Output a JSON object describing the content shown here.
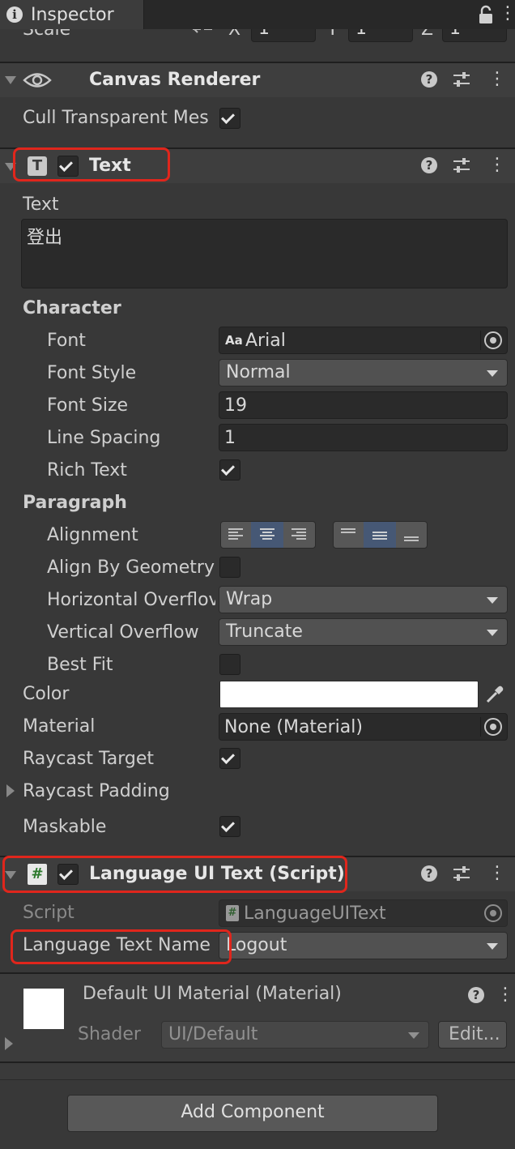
{
  "window": {
    "tab_title": "Inspector"
  },
  "transform": {
    "scale_label": "Scale",
    "x_label": "X",
    "y_label": "Y",
    "z_label": "Z",
    "x": "1",
    "y": "1",
    "z": "1"
  },
  "canvas_renderer": {
    "title": "Canvas Renderer",
    "cull_label": "Cull Transparent Mes"
  },
  "text_component": {
    "title": "Text",
    "text_label": "Text",
    "text_value": "登出",
    "character_header": "Character",
    "font_label": "Font",
    "font_icon": "Aa",
    "font_value": "Arial",
    "font_style_label": "Font Style",
    "font_style_value": "Normal",
    "font_size_label": "Font Size",
    "font_size_value": "19",
    "line_spacing_label": "Line Spacing",
    "line_spacing_value": "1",
    "rich_text_label": "Rich Text",
    "paragraph_header": "Paragraph",
    "alignment_label": "Alignment",
    "align_by_geometry_label": "Align By Geometry",
    "horizontal_overflow_label": "Horizontal Overflov",
    "horizontal_overflow_value": "Wrap",
    "vertical_overflow_label": "Vertical Overflow",
    "vertical_overflow_value": "Truncate",
    "best_fit_label": "Best Fit",
    "color_label": "Color",
    "material_label": "Material",
    "material_value": "None (Material)",
    "raycast_target_label": "Raycast Target",
    "raycast_padding_label": "Raycast Padding",
    "maskable_label": "Maskable"
  },
  "language_component": {
    "title": "Language UI Text (Script)",
    "script_label": "Script",
    "script_value": "LanguageUIText",
    "text_name_label": "Language Text Name",
    "text_name_value": "Logout"
  },
  "material_preview": {
    "title": "Default UI Material (Material)",
    "shader_label": "Shader",
    "shader_value": "UI/Default",
    "edit_label": "Edit..."
  },
  "footer": {
    "add_component_label": "Add Component"
  },
  "icons": {
    "component_text_glyph": "T",
    "component_script_glyph": "#",
    "help_glyph": "?",
    "info_glyph": "i"
  },
  "colors": {
    "highlight_red": "#e0261c",
    "selected_blue": "#465875",
    "panel_bg": "#383838"
  }
}
